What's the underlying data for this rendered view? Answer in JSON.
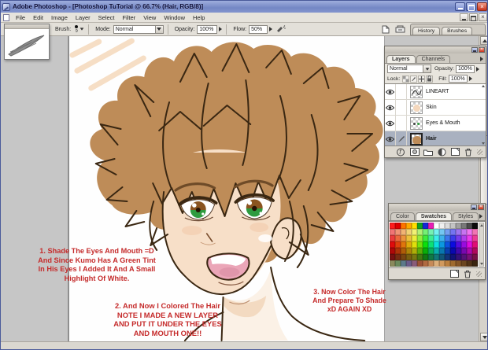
{
  "window": {
    "title": "Adobe Photoshop - [Photoshop TuTorial @ 66.7% (Hair, RGB/8)]"
  },
  "menu": {
    "items": [
      "File",
      "Edit",
      "Image",
      "Layer",
      "Select",
      "Filter",
      "View",
      "Window",
      "Help"
    ]
  },
  "options_bar": {
    "brush_label": "Brush:",
    "brush_size": "9",
    "mode_label": "Mode:",
    "mode_value": "Normal",
    "opacity_label": "Opacity:",
    "opacity_value": "100%",
    "flow_label": "Flow:",
    "flow_value": "50%",
    "palette_well_tabs": [
      "History",
      "Brushes"
    ]
  },
  "layers_palette": {
    "tabs": [
      "Layers",
      "Channels"
    ],
    "blend_mode": "Normal",
    "opacity_label": "Opacity:",
    "opacity_value": "100%",
    "lock_label": "Lock:",
    "fill_label": "Fill:",
    "fill_value": "100%",
    "layers": [
      {
        "name": "LINEART",
        "selected": false,
        "editing": false,
        "thumb": "lineart"
      },
      {
        "name": "Skin",
        "selected": false,
        "editing": false,
        "thumb": "skin"
      },
      {
        "name": "Eyes & Mouth",
        "selected": false,
        "editing": false,
        "thumb": "eyes"
      },
      {
        "name": "Hair",
        "selected": true,
        "editing": true,
        "thumb": "hair"
      }
    ]
  },
  "swatches_palette": {
    "tabs": [
      "Color",
      "Swatches",
      "Styles"
    ],
    "active_tab": "Swatches",
    "grid": [
      [
        "#FF1C1C",
        "#E00000",
        "#FF7300",
        "#FFA800",
        "#FFE000",
        "#12A121",
        "#1726D8",
        "#E81CB4",
        "#FFFFFF",
        "#F0F0F0",
        "#DBDBDB",
        "#C4C4C4",
        "#A0A0A0",
        "#787878",
        "#4B4B4B",
        "#0A0A0A"
      ],
      [
        "hsl(0,82%,70%)",
        "hsl(15,82%,70%)",
        "hsl(30,82%,70%)",
        "hsl(45,82%,70%)",
        "hsl(60,82%,70%)",
        "hsl(90,82%,70%)",
        "hsl(120,82%,70%)",
        "hsl(150,82%,70%)",
        "hsl(180,82%,70%)",
        "hsl(200,82%,70%)",
        "hsl(220,82%,70%)",
        "hsl(240,82%,70%)",
        "hsl(260,82%,70%)",
        "hsl(280,82%,70%)",
        "hsl(300,82%,70%)",
        "hsl(330,82%,70%)"
      ],
      [
        "hsl(0,82%,58%)",
        "hsl(15,82%,58%)",
        "hsl(30,82%,58%)",
        "hsl(45,82%,58%)",
        "hsl(60,82%,58%)",
        "hsl(90,82%,58%)",
        "hsl(120,82%,58%)",
        "hsl(150,82%,58%)",
        "hsl(180,82%,58%)",
        "hsl(200,82%,58%)",
        "hsl(220,82%,58%)",
        "hsl(240,82%,58%)",
        "hsl(260,82%,58%)",
        "hsl(280,82%,58%)",
        "hsl(300,82%,58%)",
        "hsl(330,82%,58%)"
      ],
      [
        "hsl(0,90%,46%)",
        "hsl(15,90%,46%)",
        "hsl(30,90%,46%)",
        "hsl(45,90%,46%)",
        "hsl(60,90%,46%)",
        "hsl(90,90%,46%)",
        "hsl(120,90%,46%)",
        "hsl(150,90%,46%)",
        "hsl(180,90%,46%)",
        "hsl(200,90%,46%)",
        "hsl(220,90%,46%)",
        "hsl(240,90%,46%)",
        "hsl(260,90%,46%)",
        "hsl(280,90%,46%)",
        "hsl(300,90%,46%)",
        "hsl(330,90%,46%)"
      ],
      [
        "hsl(0,90%,36%)",
        "hsl(15,90%,36%)",
        "hsl(30,90%,36%)",
        "hsl(45,90%,36%)",
        "hsl(60,90%,36%)",
        "hsl(90,90%,36%)",
        "hsl(120,90%,36%)",
        "hsl(150,90%,36%)",
        "hsl(180,90%,36%)",
        "hsl(200,90%,36%)",
        "hsl(220,90%,36%)",
        "hsl(240,90%,36%)",
        "hsl(260,90%,36%)",
        "hsl(280,90%,36%)",
        "hsl(300,90%,36%)",
        "hsl(330,90%,36%)"
      ],
      [
        "hsl(0,75%,27%)",
        "hsl(15,75%,27%)",
        "hsl(30,75%,27%)",
        "hsl(45,75%,27%)",
        "hsl(60,75%,27%)",
        "hsl(90,75%,27%)",
        "hsl(120,75%,27%)",
        "hsl(150,75%,27%)",
        "hsl(180,75%,27%)",
        "hsl(200,75%,27%)",
        "hsl(220,75%,27%)",
        "hsl(240,75%,27%)",
        "hsl(260,75%,27%)",
        "hsl(280,75%,27%)",
        "hsl(300,75%,27%)",
        "hsl(330,75%,27%)"
      ],
      [
        "#8A8A5C",
        "#6B8A5C",
        "#5C7A8A",
        "#6B5C8A",
        "#8A5C7A",
        "#9C5236",
        "#B06A40",
        "#C68A57",
        "#DCAF7A",
        "#D19A5E",
        "#BA7F3F",
        "#9F6A2E",
        "#855627",
        "#6B451F",
        "#523418",
        "#3A2510"
      ]
    ]
  },
  "annotations": {
    "color": "#C52B2B",
    "note1": {
      "lines": [
        "1. Shade The Eyes And Mouth =D",
        "And Since Kumo Has A Green Tint",
        "In His Eyes I Added It And A Small",
        "Highlight Of White."
      ]
    },
    "note2": {
      "lines": [
        "2. And Now I Colored The Hair",
        "NOTE I MADE A NEW LAYER",
        "AND PUT IT UNDER THE EYES",
        "AND MOUTH ONE!!"
      ]
    },
    "note3": {
      "lines": [
        "3. Now Color The Hair",
        "And Prepare To Shade",
        "xD AGAIN XD"
      ]
    }
  },
  "colors": {
    "hair": "#BE8C58",
    "line": "#3A2712",
    "skin": "#F7DFC8",
    "skin_shade": "#F1D0B0",
    "eye_green": "#2E9B3F",
    "eye_brown": "#8A5420",
    "mouth_pink": "#EBA6B8",
    "peach": "#F5D9BC",
    "neck": "#FBF1E6",
    "annotation_red": "#C52B2B",
    "workspace_gray": "#C6C6C6",
    "titlebar_blue": "#7E90C8",
    "selected_layer": "#A9B1C0"
  }
}
